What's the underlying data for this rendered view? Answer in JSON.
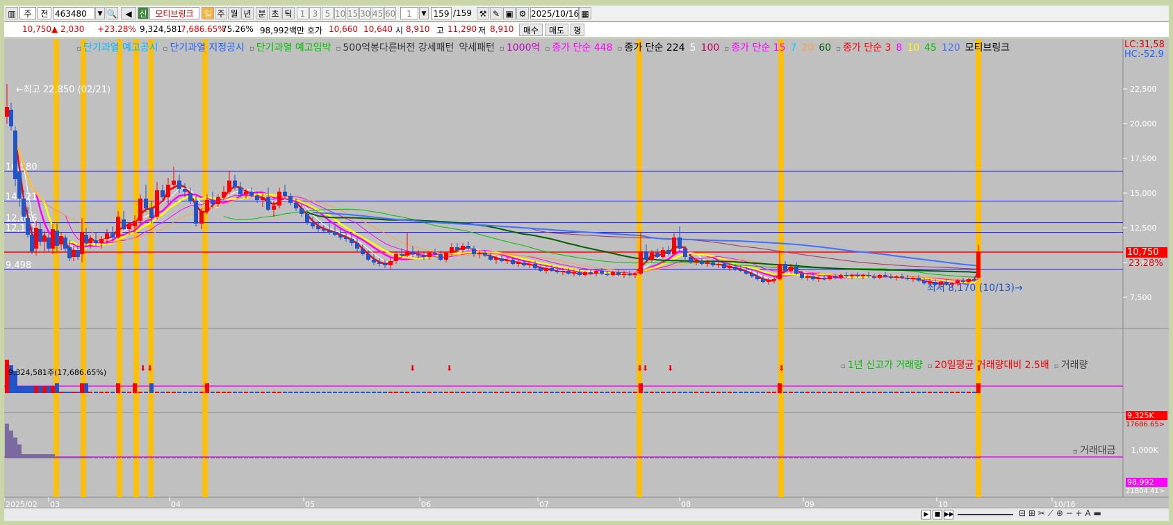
{
  "toolbar": {
    "market": "주",
    "scope": "전",
    "code": "463480",
    "name": "모티브링크",
    "periods": [
      "일",
      "주",
      "월",
      "년",
      "분",
      "초",
      "틱"
    ],
    "nums": [
      "1",
      "3",
      "5",
      "10",
      "15",
      "30",
      "45",
      "60"
    ],
    "interval": "1",
    "count": "159",
    "count_total": "/159",
    "date": "2025/10/16"
  },
  "quote": {
    "price": "10,750",
    "change": "▲ 2,030",
    "change_pct": "+23.28%",
    "volume": "9,324,581",
    "vol_ratio": "7,686.65%",
    "turnover_pct": "75.26%",
    "amount": "98,992백만",
    "hoga_label": "호가",
    "ask": "10,660",
    "bid": "10,640",
    "open_label": "시",
    "open": "8,910",
    "high_label": "고",
    "high": "11,290",
    "low_label": "저",
    "low": "8,910",
    "buy": "매수",
    "sell": "매도",
    "avg": "평"
  },
  "legend_top": [
    {
      "text": "단기과열 예고공시",
      "color": "#00b4ff"
    },
    {
      "text": "단기과열 지정공시",
      "color": "#2060ff"
    },
    {
      "text": "단기과열 예고임박",
      "color": "#00c000"
    },
    {
      "text": "500억봉다른버전 강세패턴",
      "color": "#333333"
    },
    {
      "text": "약세패턴",
      "color": "#333333"
    },
    {
      "text": "1000억",
      "color": "#c000c0"
    },
    {
      "text": "종가 단순 448",
      "color": "#ff00ff"
    },
    {
      "text": "종가 단순 224",
      "color": "#000000"
    },
    {
      "text": "5",
      "color": "#ffffff"
    },
    {
      "text": "100",
      "color": "#c00060"
    },
    {
      "text": "종가 단순 15",
      "color": "#ff00ff"
    },
    {
      "text": "7",
      "color": "#00d0ff"
    },
    {
      "text": "20",
      "color": "#ffa040"
    },
    {
      "text": "60",
      "color": "#006000"
    },
    {
      "text": "종가 단순 3",
      "color": "#ff0000"
    },
    {
      "text": "8",
      "color": "#ff00ff"
    },
    {
      "text": "10",
      "color": "#ffff00"
    },
    {
      "text": "45",
      "color": "#00c000"
    },
    {
      "text": "120",
      "color": "#4070ff"
    },
    {
      "text": "모티브링크",
      "color": "#000000"
    }
  ],
  "price_axis": [
    "22,500",
    "20,000",
    "17,500",
    "15,000",
    "12,500",
    "10,000",
    "7,500"
  ],
  "axis_flags": {
    "lc": "LC:31,58",
    "hc": "HC:-52.9"
  },
  "h_lines": [
    "16,580",
    "14,421",
    "12,866",
    "12,175",
    "9,498"
  ],
  "annotations": {
    "high": "←최고 22,850 (02/21)",
    "low": "최저 8,170 (10/13)→"
  },
  "price_tag": {
    "price": "10,750",
    "pct": "23.28%"
  },
  "volume_panel": {
    "title": "9,324,581주(17,686.65%)",
    "legend": [
      {
        "text": "1년 신고가 거래량",
        "color": "#00c000"
      },
      {
        "text": "20일평균 거래량대비 2.5배",
        "color": "#ff0000"
      },
      {
        "text": "거래량",
        "color": "#404040"
      }
    ],
    "tag": "9,325K",
    "tag2": "17686.65>"
  },
  "amount_panel": {
    "legend": "거래대금",
    "axis": "1,000K",
    "tag": "98,992",
    "tag2": "21804.41>"
  },
  "date_axis": [
    "2025/02",
    "03",
    "04",
    "05",
    "06",
    "07",
    "08",
    "09",
    "10",
    "10/16"
  ],
  "colors": {
    "up": "#ff0000",
    "down": "#1f55c8",
    "bg": "#c0c0c0",
    "highlight": "#ffc000",
    "magenta": "#ff00ff"
  }
}
